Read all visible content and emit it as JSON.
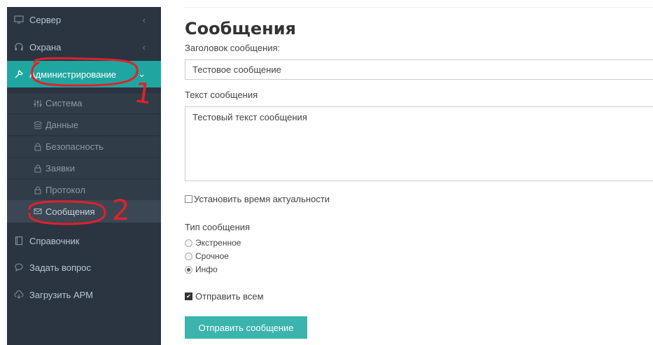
{
  "sidebar": {
    "items": [
      {
        "label": "Сервер",
        "icon": "monitor-icon",
        "chevron": "‹"
      },
      {
        "label": "Охрана",
        "icon": "headset-icon",
        "chevron": "‹"
      },
      {
        "label": "Администрирование",
        "icon": "wrench-icon",
        "chevron": "⌄"
      },
      {
        "label": "Справочник",
        "icon": "book-icon"
      },
      {
        "label": "Задать вопрос",
        "icon": "chat-icon"
      },
      {
        "label": "Загрузить АРМ",
        "icon": "cloud-download-icon"
      }
    ],
    "subitems": [
      {
        "label": "Система",
        "icon": "sliders-icon"
      },
      {
        "label": "Данные",
        "icon": "database-icon"
      },
      {
        "label": "Безопасность",
        "icon": "lock-icon"
      },
      {
        "label": "Заявки",
        "icon": "lock-icon"
      },
      {
        "label": "Протокол",
        "icon": "lock-icon"
      },
      {
        "label": "Сообщения",
        "icon": "message-icon"
      }
    ]
  },
  "annotations": {
    "mark1": "1",
    "mark2": "2"
  },
  "main": {
    "title": "Сообщения",
    "subject_label": "Заголовок сообщения:",
    "subject_value": "Тестовое сообщение",
    "text_label": "Текст сообщения",
    "text_value": "Тестовый текст сообщения",
    "set_time_label": "Установить время актуальности",
    "type_label": "Тип сообщения",
    "types": [
      "Экстренное",
      "Срочное",
      "Инфо"
    ],
    "selected_type": "Инфо",
    "send_all_label": "Отправить всем",
    "send_all_checked": true,
    "submit_label": "Отправить сообщение"
  },
  "colors": {
    "sidebar_bg": "#2a3541",
    "accent": "#20a6a0",
    "button": "#3ab4ac",
    "annotation": "#e0212b"
  }
}
